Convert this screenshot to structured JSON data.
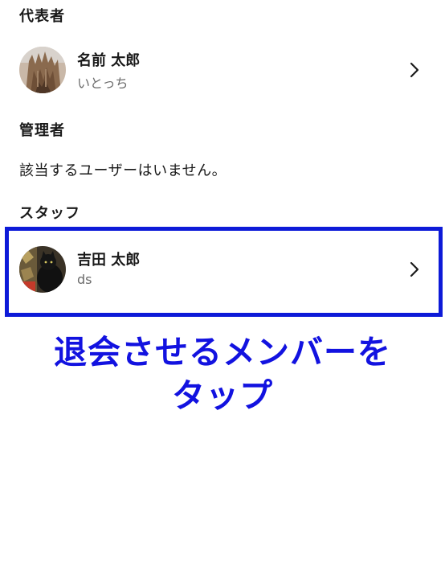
{
  "sections": {
    "representative": {
      "title": "代表者",
      "members": [
        {
          "name": "名前 太郎",
          "subtitle": "いとっち",
          "avatar_icon": "building-photo-avatar"
        }
      ]
    },
    "admin": {
      "title": "管理者",
      "empty_text": "該当するユーザーはいません。"
    },
    "staff": {
      "title": "スタッフ",
      "members": [
        {
          "name": "吉田 太郎",
          "subtitle": "ds",
          "avatar_icon": "cat-photo-avatar"
        }
      ]
    }
  },
  "annotation": {
    "line1": "退会させるメンバーを",
    "line2": "タップ",
    "highlight_color": "#0d1ad8",
    "text_color": "#1212e0"
  },
  "icons": {
    "chevron": "chevron-right-icon"
  }
}
